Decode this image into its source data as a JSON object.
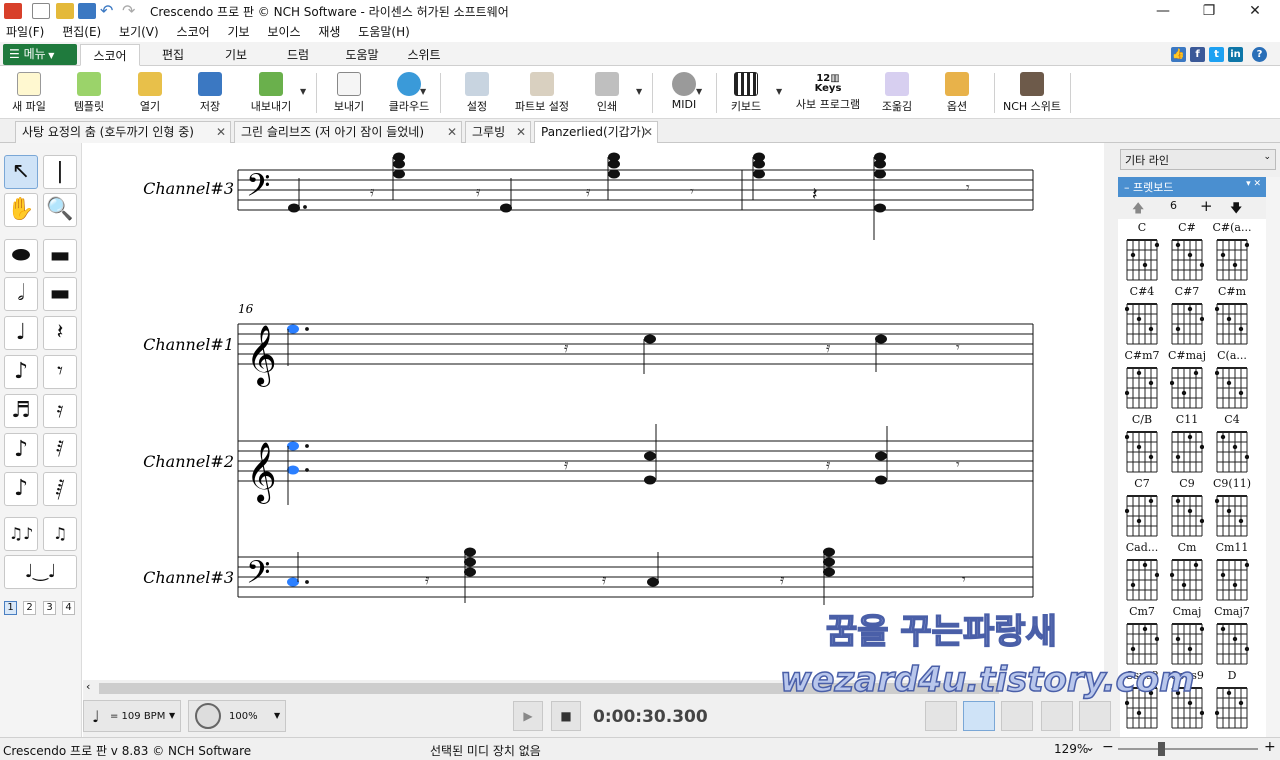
{
  "window": {
    "title": "Crescendo 프로 판 © NCH Software - 라이센스 허가된 소프트웨어"
  },
  "menubar": [
    "파일(F)",
    "편집(E)",
    "보기(V)",
    "스코어",
    "기보",
    "보이스",
    "재생",
    "도움말(H)"
  ],
  "ribbon": {
    "menu_label": "메뉴",
    "tabs": [
      "스코어",
      "편집",
      "기보",
      "드럼",
      "도움말",
      "스위트"
    ]
  },
  "toolbar": [
    "새 파일",
    "템플릿",
    "열기",
    "저장",
    "내보내기",
    "보내기",
    "클라우드",
    "설정",
    "파트보 설정",
    "인쇄",
    "MIDI",
    "키보드",
    "사보 프로그램",
    "조옮김",
    "옵션",
    "NCH 스위트"
  ],
  "doc_tabs": [
    {
      "label": "사탕 요정의 춤 (호두까기 인형 중)"
    },
    {
      "label": "그린 슬리브즈 (저 아기 잠이 들었네)"
    },
    {
      "label": "그루빙"
    },
    {
      "label": "Panzerlied(기갑가)"
    }
  ],
  "score": {
    "measure_number": "16",
    "staff_labels": [
      "Channel#3",
      "Channel#1",
      "Channel#2",
      "Channel#3"
    ],
    "keys_label": "Keys",
    "keys_number": "12"
  },
  "palette": {
    "pages": [
      "1",
      "2",
      "3",
      "4"
    ]
  },
  "right_panel": {
    "dropdown": "기타 라인",
    "header": "프렛보드",
    "fret_count": "6",
    "chords": [
      "C",
      "C#",
      "C#(a...",
      "C#4",
      "C#7",
      "C#m",
      "C#m7",
      "C#maj",
      "C(a...",
      "C/B",
      "C11",
      "C4",
      "C7",
      "C9",
      "C9(11)",
      "Cad...",
      "Cm",
      "Cm11",
      "Cm7",
      "Cmaj",
      "Cmaj7",
      "Csus2",
      "Csus9",
      "D"
    ]
  },
  "transport": {
    "tempo": "= 109 BPM",
    "volume": "100%",
    "time": "0:00:30.300"
  },
  "status": {
    "version": "Crescendo 프로 판 v 8.83 © NCH Software",
    "device": "선택된 미디 장치 없음",
    "zoom": "129%"
  },
  "watermark": {
    "line1": "꿈을 꾸는파랑새",
    "line2": "wezard4u.tistory.com"
  },
  "colors": {
    "menu_green": "#1f7a3d",
    "selected_note": "#2b7fff"
  }
}
